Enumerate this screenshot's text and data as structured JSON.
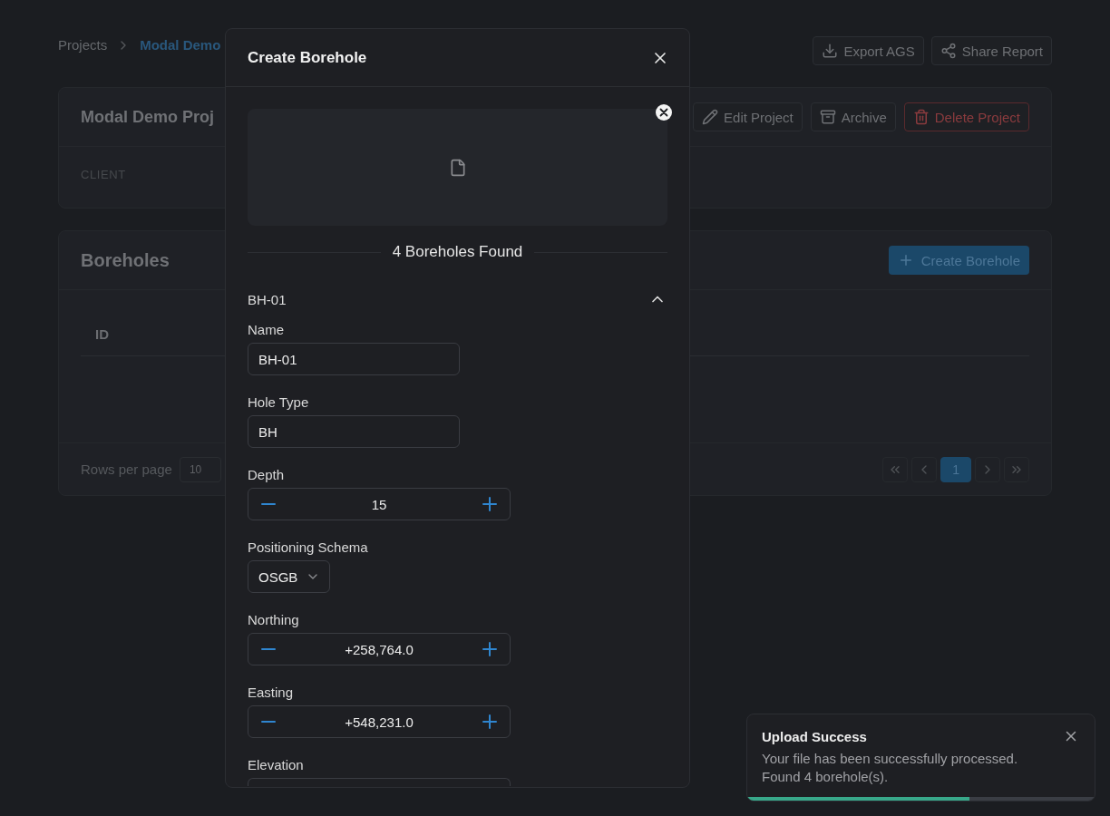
{
  "breadcrumb": [
    {
      "label": "Projects",
      "kind": "link"
    },
    {
      "label": "Modal Demo",
      "kind": "current"
    }
  ],
  "page_actions": [
    {
      "label": "Export AGS"
    },
    {
      "label": "Share Report"
    }
  ],
  "project_card": {
    "title": "Modal Demo Proj",
    "actions": [
      {
        "label": "Edit Project",
        "kind": "outline"
      },
      {
        "label": "Archive",
        "kind": "outline"
      },
      {
        "label": "Delete Project",
        "kind": "danger"
      }
    ],
    "field_label": "CLIENT"
  },
  "boreholes_card": {
    "title": "Boreholes",
    "action": "Create Borehole",
    "table": {
      "columns": [
        "ID"
      ]
    },
    "rows_per_page_label": "Rows per page",
    "rows_per_page": "10",
    "pages": [
      {
        "label": "1",
        "selected": true
      }
    ]
  },
  "modal": {
    "title": "Create Borehole",
    "found_label": "4 Boreholes Found",
    "boreholes": [
      {
        "name": "BH-01",
        "expanded": true,
        "fields": [
          {
            "kind": "text",
            "label": "Name",
            "value": "BH-01"
          },
          {
            "kind": "text",
            "label": "Hole Type",
            "value": "BH"
          },
          {
            "kind": "number",
            "label": "Depth",
            "value": "15"
          },
          {
            "kind": "select",
            "label": "Positioning Schema",
            "value": "OSGB"
          },
          {
            "kind": "number",
            "label": "Northing",
            "value": "+258,764.0"
          },
          {
            "kind": "number",
            "label": "Easting",
            "value": "+548,231.0"
          },
          {
            "kind": "number",
            "label": "Elevation"
          }
        ]
      }
    ]
  },
  "toast": {
    "title": "Upload Success",
    "message": "Your file has been successfully processed.\nFound 4 borehole(s).",
    "level": 0.64
  }
}
